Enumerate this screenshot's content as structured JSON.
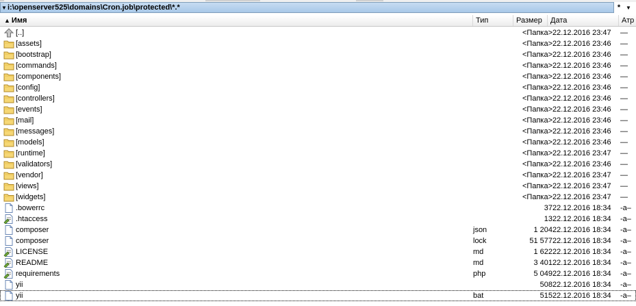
{
  "path": {
    "text": "i:\\openserver525\\domains\\Cron.job\\protected\\*.*",
    "star": "*"
  },
  "columns": {
    "name": "Имя",
    "type": "Тип",
    "size": "Размер",
    "date": "Дата",
    "attr": "Атр"
  },
  "rows": [
    {
      "icon": "up",
      "name": "[..]",
      "type": "",
      "size": "<Папка>",
      "date": "22.12.2016 23:47",
      "attr": "—"
    },
    {
      "icon": "folder",
      "name": "[assets]",
      "type": "",
      "size": "<Папка>",
      "date": "22.12.2016 23:46",
      "attr": "—"
    },
    {
      "icon": "folder",
      "name": "[bootstrap]",
      "type": "",
      "size": "<Папка>",
      "date": "22.12.2016 23:46",
      "attr": "—"
    },
    {
      "icon": "folder",
      "name": "[commands]",
      "type": "",
      "size": "<Папка>",
      "date": "22.12.2016 23:46",
      "attr": "—"
    },
    {
      "icon": "folder",
      "name": "[components]",
      "type": "",
      "size": "<Папка>",
      "date": "22.12.2016 23:46",
      "attr": "—"
    },
    {
      "icon": "folder",
      "name": "[config]",
      "type": "",
      "size": "<Папка>",
      "date": "22.12.2016 23:46",
      "attr": "—"
    },
    {
      "icon": "folder",
      "name": "[controllers]",
      "type": "",
      "size": "<Папка>",
      "date": "22.12.2016 23:46",
      "attr": "—"
    },
    {
      "icon": "folder",
      "name": "[events]",
      "type": "",
      "size": "<Папка>",
      "date": "22.12.2016 23:46",
      "attr": "—"
    },
    {
      "icon": "folder",
      "name": "[mail]",
      "type": "",
      "size": "<Папка>",
      "date": "22.12.2016 23:46",
      "attr": "—"
    },
    {
      "icon": "folder",
      "name": "[messages]",
      "type": "",
      "size": "<Папка>",
      "date": "22.12.2016 23:46",
      "attr": "—"
    },
    {
      "icon": "folder",
      "name": "[models]",
      "type": "",
      "size": "<Папка>",
      "date": "22.12.2016 23:46",
      "attr": "—"
    },
    {
      "icon": "folder",
      "name": "[runtime]",
      "type": "",
      "size": "<Папка>",
      "date": "22.12.2016 23:47",
      "attr": "—"
    },
    {
      "icon": "folder",
      "name": "[validators]",
      "type": "",
      "size": "<Папка>",
      "date": "22.12.2016 23:46",
      "attr": "—"
    },
    {
      "icon": "folder",
      "name": "[vendor]",
      "type": "",
      "size": "<Папка>",
      "date": "22.12.2016 23:47",
      "attr": "—"
    },
    {
      "icon": "folder",
      "name": "[views]",
      "type": "",
      "size": "<Папка>",
      "date": "22.12.2016 23:47",
      "attr": "—"
    },
    {
      "icon": "folder",
      "name": "[widgets]",
      "type": "",
      "size": "<Папка>",
      "date": "22.12.2016 23:47",
      "attr": "—"
    },
    {
      "icon": "file",
      "name": ".bowerrc",
      "type": "",
      "size": "37",
      "date": "22.12.2016 18:34",
      "attr": "-a–"
    },
    {
      "icon": "textfile",
      "name": ".htaccess",
      "type": "",
      "size": "13",
      "date": "22.12.2016 18:34",
      "attr": "-a–"
    },
    {
      "icon": "file",
      "name": "composer",
      "type": "json",
      "size": "1 204",
      "date": "22.12.2016 18:34",
      "attr": "-a–"
    },
    {
      "icon": "file",
      "name": "composer",
      "type": "lock",
      "size": "51 577",
      "date": "22.12.2016 18:34",
      "attr": "-a–"
    },
    {
      "icon": "textfile",
      "name": "LICENSE",
      "type": "md",
      "size": "1 622",
      "date": "22.12.2016 18:34",
      "attr": "-a–"
    },
    {
      "icon": "textfile",
      "name": "README",
      "type": "md",
      "size": "3 401",
      "date": "22.12.2016 18:34",
      "attr": "-a–"
    },
    {
      "icon": "textfile",
      "name": "requirements",
      "type": "php",
      "size": "5 049",
      "date": "22.12.2016 18:34",
      "attr": "-a–"
    },
    {
      "icon": "file",
      "name": "yii",
      "type": "",
      "size": "508",
      "date": "22.12.2016 18:34",
      "attr": "-a–"
    },
    {
      "icon": "file",
      "name": "yii",
      "type": "bat",
      "size": "515",
      "date": "22.12.2016 18:34",
      "attr": "-a–",
      "selected": true
    }
  ]
}
